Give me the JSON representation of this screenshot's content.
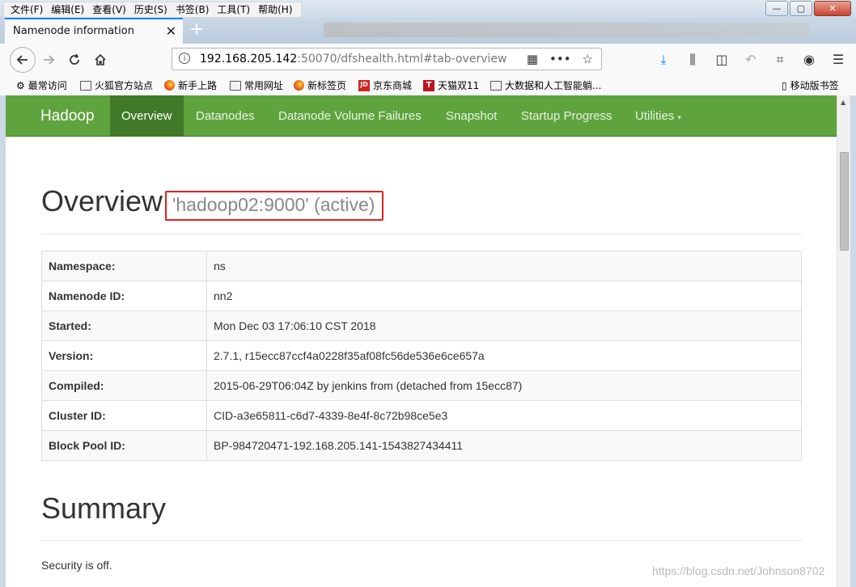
{
  "menu": [
    "文件(F)",
    "编辑(E)",
    "查看(V)",
    "历史(S)",
    "书签(B)",
    "工具(T)",
    "帮助(H)"
  ],
  "window": {
    "minimize": "—",
    "maximize": "▢",
    "close": "✕"
  },
  "tab": {
    "title": "Namenode information",
    "close": "✕",
    "new": "+"
  },
  "url": {
    "host": "192.168.205.142",
    "rest": ":50070/dfshealth.html#tab-overview"
  },
  "bookmarks": [
    "最常访问",
    "火狐官方站点",
    "新手上路",
    "常用网址",
    "新标签页",
    "京东商城",
    "天猫双11",
    "大数据和人工智能躺...",
    "移动版书签"
  ],
  "bookmark_icon_text": {
    "jd": "JD",
    "tm": "T"
  },
  "nav": {
    "brand": "Hadoop",
    "items": [
      "Overview",
      "Datanodes",
      "Datanode Volume Failures",
      "Snapshot",
      "Startup Progress",
      "Utilities"
    ],
    "caret": "▾"
  },
  "overview": {
    "title": "Overview",
    "status": "'hadoop02:9000' (active)",
    "rows": [
      {
        "k": "Namespace:",
        "v": "ns"
      },
      {
        "k": "Namenode ID:",
        "v": "nn2"
      },
      {
        "k": "Started:",
        "v": "Mon Dec 03 17:06:10 CST 2018"
      },
      {
        "k": "Version:",
        "v": "2.7.1, r15ecc87ccf4a0228f35af08fc56de536e6ce657a"
      },
      {
        "k": "Compiled:",
        "v": "2015-06-29T06:04Z by jenkins from (detached from 15ecc87)"
      },
      {
        "k": "Cluster ID:",
        "v": "CID-a3e65811-c6d7-4339-8e4f-8c72b98ce5e3"
      },
      {
        "k": "Block Pool ID:",
        "v": "BP-984720471-192.168.205.141-1543827434411"
      }
    ]
  },
  "summary": {
    "title": "Summary",
    "security": "Security is off."
  },
  "watermark": "https://blog.csdn.net/Johnson8702"
}
